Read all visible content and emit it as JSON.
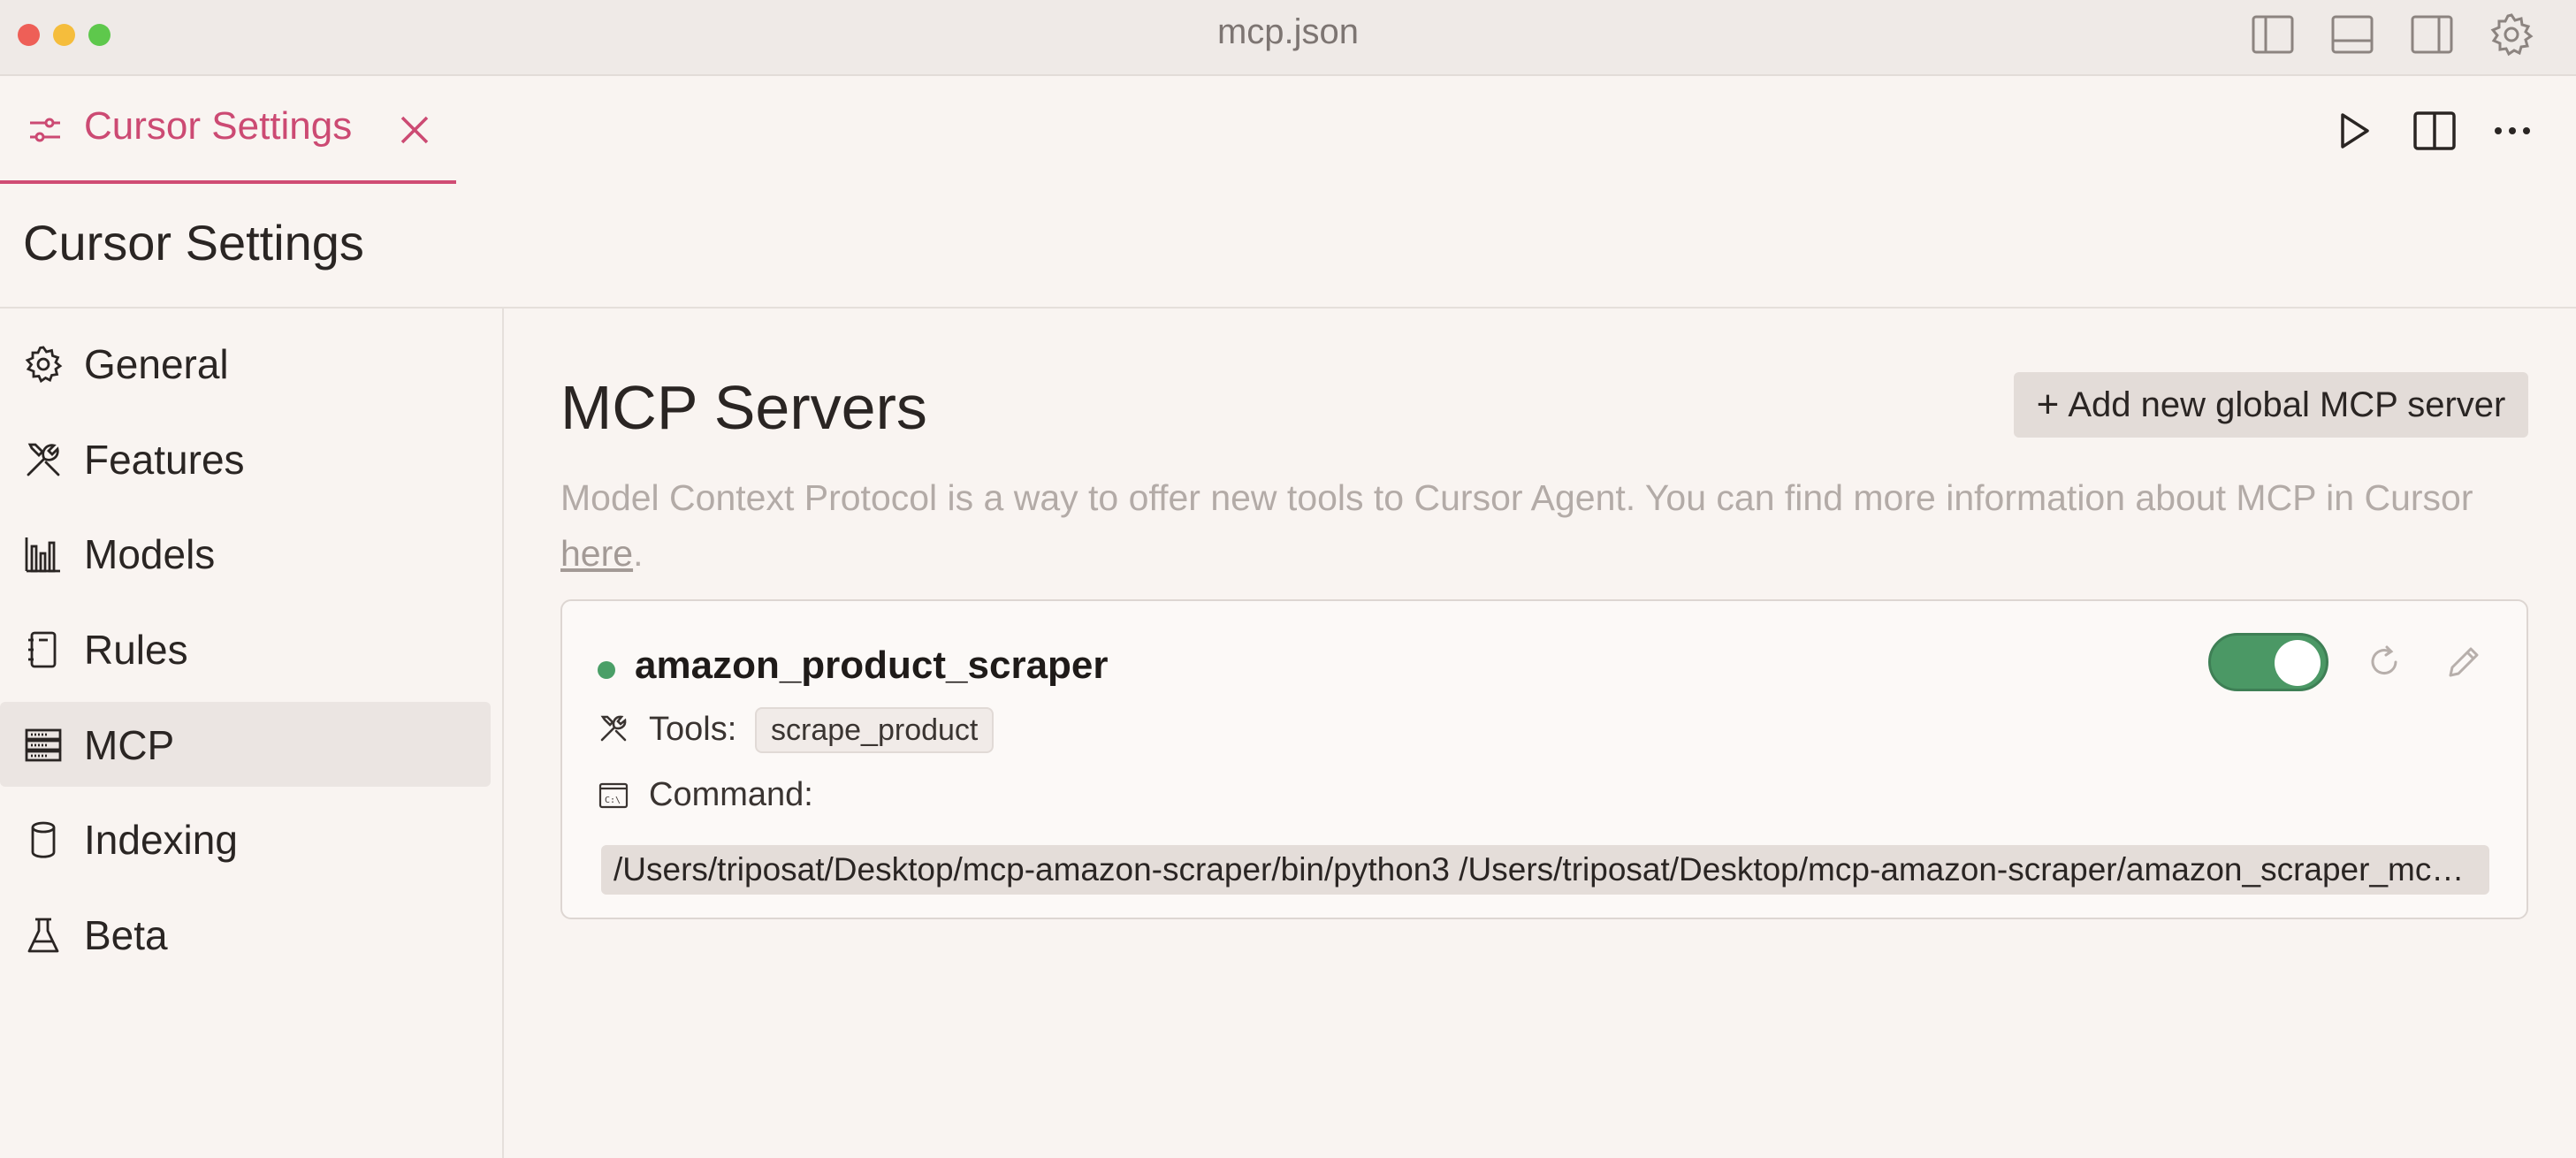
{
  "window": {
    "title": "mcp.json"
  },
  "tab": {
    "label": "Cursor Settings"
  },
  "page": {
    "title": "Cursor Settings"
  },
  "sidebar": {
    "items": [
      {
        "label": "General",
        "icon": "gear-icon"
      },
      {
        "label": "Features",
        "icon": "tools-icon"
      },
      {
        "label": "Models",
        "icon": "bar-chart-icon"
      },
      {
        "label": "Rules",
        "icon": "notebook-icon"
      },
      {
        "label": "MCP",
        "icon": "server-icon",
        "active": true
      },
      {
        "label": "Indexing",
        "icon": "database-icon"
      },
      {
        "label": "Beta",
        "icon": "flask-icon"
      }
    ]
  },
  "main": {
    "section_title": "MCP Servers",
    "add_button_label": "Add new global MCP server",
    "description_text": "Model Context Protocol is a way to offer new tools to Cursor Agent. You can find more information about MCP in Cursor ",
    "description_link": "here",
    "description_end": "."
  },
  "server": {
    "name": "amazon_product_scraper",
    "status_color": "#4a9f67",
    "enabled": true,
    "tools_label": "Tools:",
    "tools": [
      "scrape_product"
    ],
    "command_label": "Command:",
    "command": "/Users/triposat/Desktop/mcp-amazon-scraper/bin/python3 /Users/triposat/Desktop/mcp-amazon-scraper/amazon_scraper_mcp.py"
  },
  "colors": {
    "accent": "#cc4a73",
    "toggle_on": "#4b9865"
  }
}
